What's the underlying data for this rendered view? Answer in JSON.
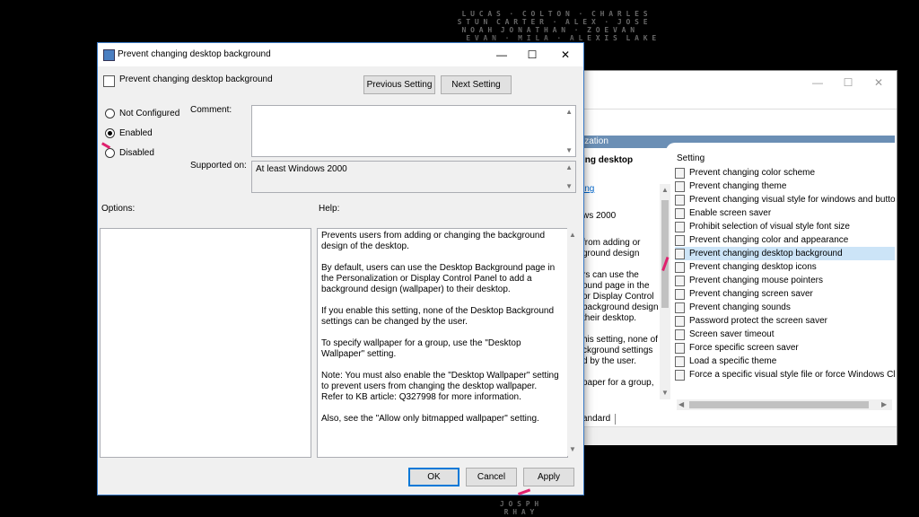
{
  "dialog": {
    "title": "Prevent changing desktop background",
    "setting_name": "Prevent changing desktop background",
    "prev_button": "Previous Setting",
    "next_button": "Next Setting",
    "radio_not_configured": "Not Configured",
    "radio_enabled": "Enabled",
    "radio_disabled": "Disabled",
    "selected_radio": "Enabled",
    "comment_label": "Comment:",
    "comment_value": "",
    "supported_label": "Supported on:",
    "supported_value": "At least Windows 2000",
    "options_label": "Options:",
    "help_label": "Help:",
    "help": {
      "p1": "Prevents users from adding or changing the background design of the desktop.",
      "p2": "By default, users can use the Desktop Background page in the Personalization or Display Control Panel to add a background design (wallpaper) to their desktop.",
      "p3": "If you enable this setting, none of the Desktop Background settings can be changed by the user.",
      "p4": "To specify wallpaper for a group, use the \"Desktop Wallpaper\" setting.",
      "p5": "Note: You must also enable the \"Desktop Wallpaper\" setting to prevent users from changing the desktop wallpaper. Refer to KB article: Q327998 for more information.",
      "p6": "Also, see the \"Allow only bitmapped wallpaper\" setting."
    },
    "ok_button": "OK",
    "cancel_button": "Cancel",
    "apply_button": "Apply"
  },
  "background_window": {
    "header_fragment": "ization",
    "left_title": "ing desktop",
    "left_link": "ing",
    "left_os": "ws 2000",
    "left_lines": [
      "from adding or",
      "ground design",
      "",
      "rs can use the",
      "ound page in the",
      " or Display Control",
      "background design",
      "their desktop.",
      "",
      "his setting, none of",
      "ckground settings",
      "d by the user.",
      "",
      "paper for a group,"
    ],
    "tab_fragment": "andard",
    "column_header": "Setting",
    "settings": [
      "Prevent changing color scheme",
      "Prevent changing theme",
      "Prevent changing visual style for windows and buttons",
      "Enable screen saver",
      "Prohibit selection of visual style font size",
      "Prevent changing color and appearance",
      "Prevent changing desktop background",
      "Prevent changing desktop icons",
      "Prevent changing mouse pointers",
      "Prevent changing screen saver",
      "Prevent changing sounds",
      "Password protect the screen saver",
      "Screen saver timeout",
      "Force specific screen saver",
      "Load a specific theme",
      "Force a specific visual style file or force Windows Class"
    ],
    "selected_setting": "Prevent changing desktop background"
  },
  "colors": {
    "accent": "#0078d7",
    "annotation_pink": "#e0216e",
    "header_bar": "#6b8fb5"
  },
  "icons": [
    "policy-icon",
    "close-icon",
    "maximize-icon",
    "minimize-icon",
    "setting-icon"
  ]
}
